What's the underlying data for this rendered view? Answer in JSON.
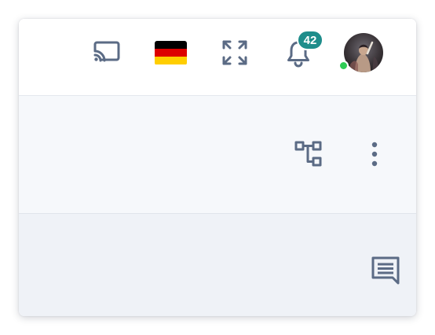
{
  "header": {
    "icons": {
      "cast": "cast-icon",
      "language_flag": "germany-flag-icon",
      "fullscreen": "fullscreen-expand-icon",
      "notifications": "bell-icon",
      "user": "avatar"
    },
    "notifications": {
      "count": "42",
      "badge_color": "#1e8d8b"
    },
    "user_status": {
      "status_color": "#2ecc55"
    },
    "flag_colors": [
      "#000000",
      "#dd0000",
      "#ffce00"
    ]
  },
  "toolbar": {
    "icons": {
      "hierarchy": "hierarchy-icon",
      "more": "more-vertical-icon"
    }
  },
  "content": {
    "icons": {
      "chat": "chat-icon"
    }
  },
  "colors": {
    "icon": "#5b6b85",
    "topbar_bg": "#ffffff",
    "toolbar_bg": "#f6f8fb",
    "content_bg": "#eff2f7"
  }
}
